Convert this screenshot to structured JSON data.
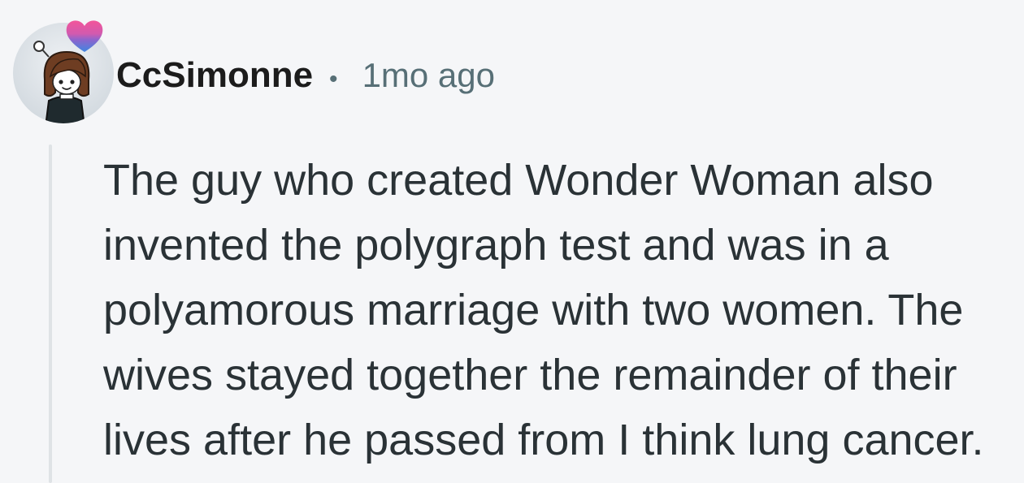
{
  "comment": {
    "author": "CcSimonne",
    "separator": "•",
    "timestamp": "1mo ago",
    "body_lines": [
      "The guy who created Wonder Woman also",
      "invented the polygraph test and was in a",
      "polyamorous marriage with two women. The",
      "wives stayed together the remainder of their",
      "lives after he passed from I think lung cancer."
    ]
  },
  "avatar": {
    "icon": "user-avatar-icon",
    "accessory_icon": "heart-icon"
  },
  "colors": {
    "background": "#f5f6f8",
    "author": "#1c1c1c",
    "meta": "#576f76",
    "body": "#2a3236",
    "thread_line": "#dfe3e6"
  }
}
